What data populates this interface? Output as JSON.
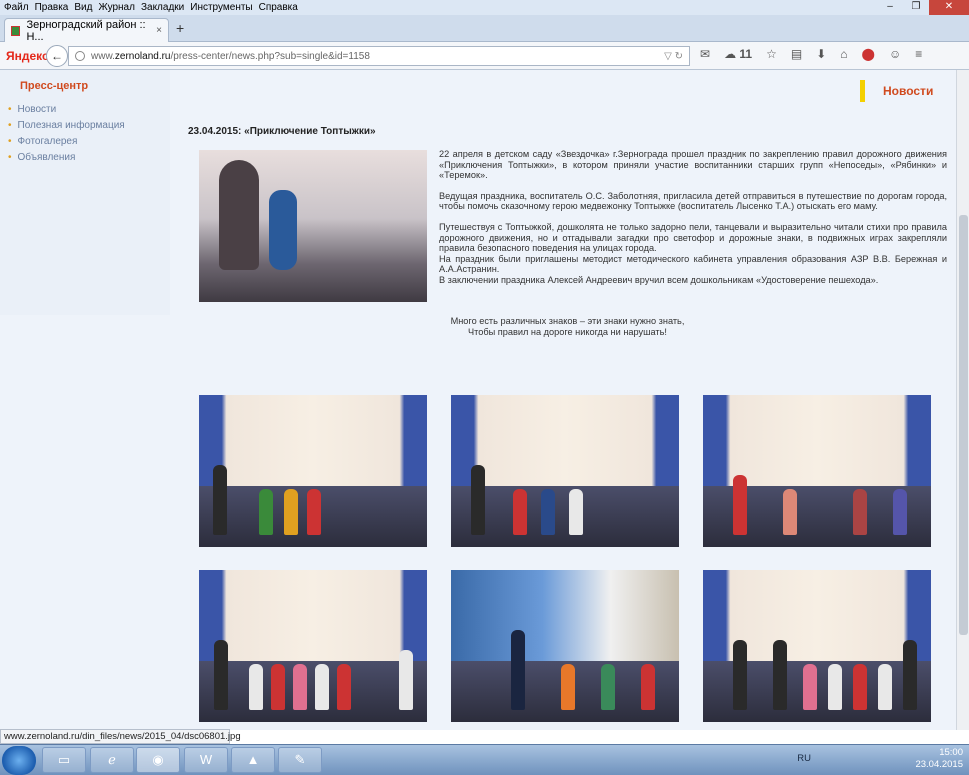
{
  "menu": [
    "Файл",
    "Правка",
    "Вид",
    "Журнал",
    "Закладки",
    "Инструменты",
    "Справка"
  ],
  "tab": {
    "title": "Зерноградский район :: Н...",
    "close": "×",
    "new": "+"
  },
  "browser": {
    "yandex_logo": "Яндекс",
    "url_prefix": "www.",
    "url_host": "zernoland.ru",
    "url_path": "/press-center/news.php?sub=single&id=1158",
    "mail_count": "11"
  },
  "sidebar": {
    "heading": "Пресс-центр",
    "items": [
      "Новости",
      "Полезная информация",
      "Фотогалерея",
      "Объявления"
    ]
  },
  "news_badge": "Новости",
  "article": {
    "date_title": "23.04.2015: «Приключение Топтыжки»",
    "p1": "22 апреля в детском саду «Звездочка» г.Зернограда прошел праздник по закреплению правил дорожного движения «Приключения Топтыжки», в котором приняли участие воспитанники старших групп «Непоседы», «Рябинки» и «Теремок».",
    "p2": "Ведущая праздника, воспитатель О.С. Заболотняя, пригласила детей отправиться в путешествие по дорогам города, чтобы помочь сказочному герою медвежонку Топтыжке (воспитатель Лысенко Т.А.) отыскать его маму.",
    "p3": "Путешествуя с Топтыжкой, дошколята не только задорно пели, танцевали и выразительно читали стихи про правила дорожного движения, но и отгадывали загадки про светофор и дорожные знаки, в подвижных играх закрепляли правила безопасного поведения на улицах города.",
    "p4": "На праздник были приглашены методист методического кабинета управления образования АЗР В.В. Бережная и А.А.Астранин.",
    "p5": "В заключении праздника Алексей Андреевич вручил всем дошкольникам «Удостоверение пешехода».",
    "poem1": "Много есть различных знаков – эти знаки нужно знать,",
    "poem2": "Чтобы правил на дороге никогда ни нарушать!"
  },
  "status_url": "www.zernoland.ru/din_files/news/2015_04/dsc06801.jpg",
  "tray": {
    "lang": "RU",
    "time": "15:00",
    "date": "23.04.2015"
  }
}
